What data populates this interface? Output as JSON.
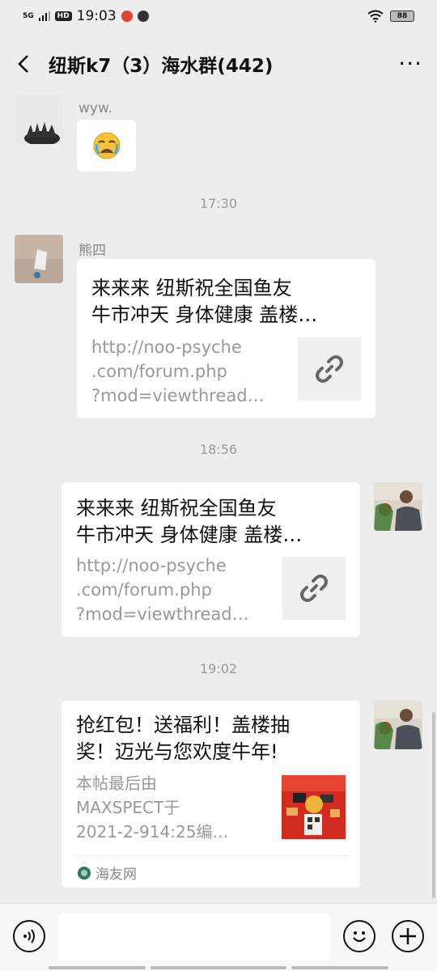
{
  "status_bar": {
    "signal_label": "5G",
    "hd_label": "HD",
    "time": "19:03",
    "battery": "88"
  },
  "header": {
    "title": "纽斯k7（3）海水群(442)"
  },
  "messages": [
    {
      "type": "emoji",
      "sender": "wyw.",
      "emoji": "😭"
    },
    {
      "type": "time",
      "text": "17:30"
    },
    {
      "type": "link",
      "sender": "熊四",
      "title": "来来来 纽斯祝全国鱼友牛市冲天 身体健康 盖楼…",
      "title_line1": "来来来 纽斯祝全国鱼友",
      "title_line2": "牛市冲天 身体健康 盖楼…",
      "desc_line1": "http://noo-psyche",
      "desc_line2": ".com/forum.php",
      "desc_line3": "?mod=viewthread…"
    },
    {
      "type": "time",
      "text": "18:56"
    },
    {
      "type": "link",
      "sender": "self",
      "title_line1": "来来来 纽斯祝全国鱼友",
      "title_line2": "牛市冲天 身体健康 盖楼…",
      "desc_line1": "http://noo-psyche",
      "desc_line2": ".com/forum.php",
      "desc_line3": "?mod=viewthread…"
    },
    {
      "type": "time",
      "text": "19:02"
    },
    {
      "type": "link_source",
      "sender": "self",
      "title_line1": "抢红包！送福利！盖楼抽",
      "title_line2": "奖！迈光与您欢度牛年!",
      "desc_line1": "本帖最后由",
      "desc_line2": "MAXSPECT于",
      "desc_line3": "2021-2-914:25编…",
      "source": "海友网"
    }
  ],
  "input_bar": {
    "placeholder": ""
  },
  "colors": {
    "background": "#ededed",
    "bubble": "#ffffff",
    "red_packet": "#d22b1f"
  }
}
